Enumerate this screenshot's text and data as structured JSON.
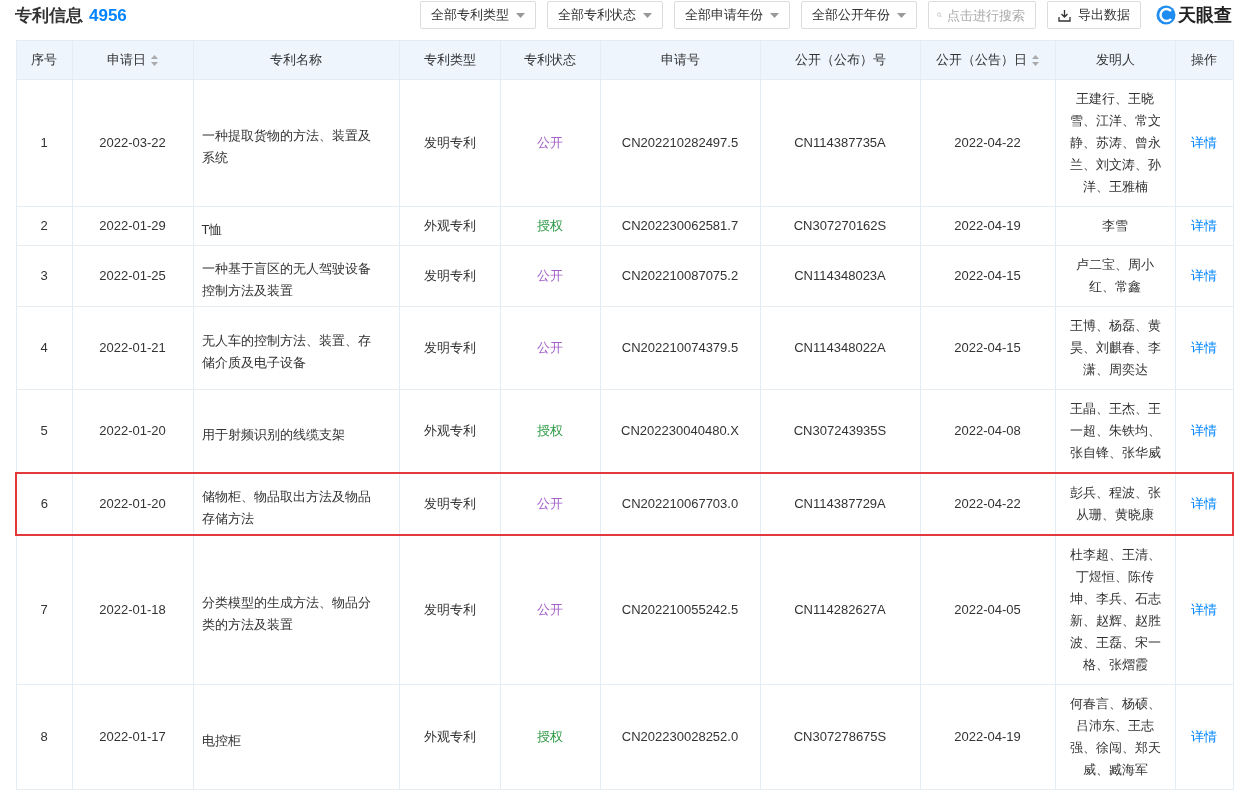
{
  "header": {
    "title": "专利信息",
    "count": "4956",
    "filters": [
      "全部专利类型",
      "全部专利状态",
      "全部申请年份",
      "全部公开年份"
    ],
    "search": {
      "placeholder": "点击进行搜索"
    },
    "export_button": "导出数据",
    "logo": "天眼查"
  },
  "table": {
    "columns": [
      {
        "label": "序号",
        "sortable": false
      },
      {
        "label": "申请日",
        "sortable": true
      },
      {
        "label": "专利名称",
        "sortable": false
      },
      {
        "label": "专利类型",
        "sortable": false
      },
      {
        "label": "专利状态",
        "sortable": false
      },
      {
        "label": "申请号",
        "sortable": false
      },
      {
        "label": "公开（公布）号",
        "sortable": false
      },
      {
        "label": "公开（公告）日",
        "sortable": true
      },
      {
        "label": "发明人",
        "sortable": false
      },
      {
        "label": "操作",
        "sortable": false
      }
    ],
    "rows": [
      {
        "no": "1",
        "date": "2022-03-22",
        "name": "一种提取货物的方法、装置及系统",
        "type": "发明专利",
        "status": {
          "label": "公开",
          "kind": "public"
        },
        "app_no": "CN202210282497.5",
        "pub_no": "CN114387735A",
        "pub_date": "2022-04-22",
        "inventors": "王建行、王晓雪、江洋、常文静、苏涛、曾永兰、刘文涛、孙洋、王雅楠",
        "action": "详情",
        "highlighted": false
      },
      {
        "no": "2",
        "date": "2022-01-29",
        "name": "T恤",
        "type": "外观专利",
        "status": {
          "label": "授权",
          "kind": "granted"
        },
        "app_no": "CN202230062581.7",
        "pub_no": "CN307270162S",
        "pub_date": "2022-04-19",
        "inventors": "李雪",
        "action": "详情",
        "highlighted": false
      },
      {
        "no": "3",
        "date": "2022-01-25",
        "name": "一种基于盲区的无人驾驶设备控制方法及装置",
        "type": "发明专利",
        "status": {
          "label": "公开",
          "kind": "public"
        },
        "app_no": "CN202210087075.2",
        "pub_no": "CN114348023A",
        "pub_date": "2022-04-15",
        "inventors": "卢二宝、周小红、常鑫",
        "action": "详情",
        "highlighted": false
      },
      {
        "no": "4",
        "date": "2022-01-21",
        "name": "无人车的控制方法、装置、存储介质及电子设备",
        "type": "发明专利",
        "status": {
          "label": "公开",
          "kind": "public"
        },
        "app_no": "CN202210074379.5",
        "pub_no": "CN114348022A",
        "pub_date": "2022-04-15",
        "inventors": "王博、杨磊、黄昊、刘麒春、李潇、周奕达",
        "action": "详情",
        "highlighted": false
      },
      {
        "no": "5",
        "date": "2022-01-20",
        "name": "用于射频识别的线缆支架",
        "type": "外观专利",
        "status": {
          "label": "授权",
          "kind": "granted"
        },
        "app_no": "CN202230040480.X",
        "pub_no": "CN307243935S",
        "pub_date": "2022-04-08",
        "inventors": "王晶、王杰、王一超、朱铁均、张自锋、张华威",
        "action": "详情",
        "highlighted": false
      },
      {
        "no": "6",
        "date": "2022-01-20",
        "name": "储物柜、物品取出方法及物品存储方法",
        "type": "发明专利",
        "status": {
          "label": "公开",
          "kind": "public"
        },
        "app_no": "CN202210067703.0",
        "pub_no": "CN114387729A",
        "pub_date": "2022-04-22",
        "inventors": "彭兵、程波、张从珊、黄晓康",
        "action": "详情",
        "highlighted": true
      },
      {
        "no": "7",
        "date": "2022-01-18",
        "name": "分类模型的生成方法、物品分类的方法及装置",
        "type": "发明专利",
        "status": {
          "label": "公开",
          "kind": "public"
        },
        "app_no": "CN202210055242.5",
        "pub_no": "CN114282627A",
        "pub_date": "2022-04-05",
        "inventors": "杜李超、王清、丁煜恒、陈传坤、李兵、石志新、赵辉、赵胜波、王磊、宋一格、张熠霞",
        "action": "详情",
        "highlighted": false
      },
      {
        "no": "8",
        "date": "2022-01-17",
        "name": "电控柜",
        "type": "外观专利",
        "status": {
          "label": "授权",
          "kind": "granted"
        },
        "app_no": "CN202230028252.0",
        "pub_no": "CN307278675S",
        "pub_date": "2022-04-19",
        "inventors": "何春言、杨硕、吕沛东、王志强、徐闯、郑天威、臧海军",
        "action": "详情",
        "highlighted": false
      }
    ]
  }
}
